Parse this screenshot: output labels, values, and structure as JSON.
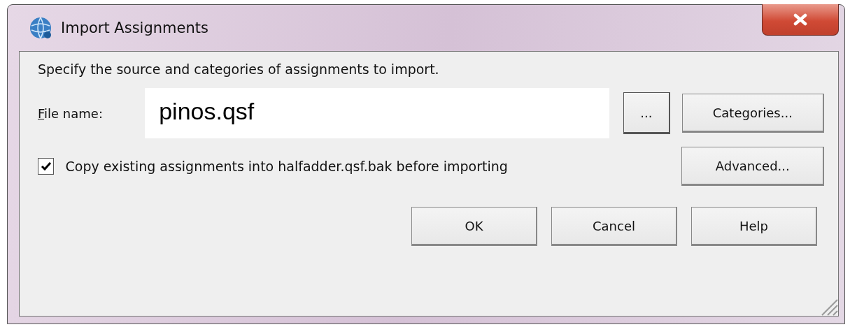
{
  "window": {
    "title": "Import Assignments"
  },
  "instruction": "Specify the source and categories of assignments to import.",
  "file_name": {
    "label": "File name:",
    "value": "pinos.qsf",
    "browse": "...",
    "categories": "Categories..."
  },
  "backup": {
    "label": "Copy existing assignments into halfadder.qsf.bak before importing",
    "checked": true
  },
  "advanced": "Advanced...",
  "buttons": [
    "OK",
    "Cancel",
    "Help"
  ]
}
